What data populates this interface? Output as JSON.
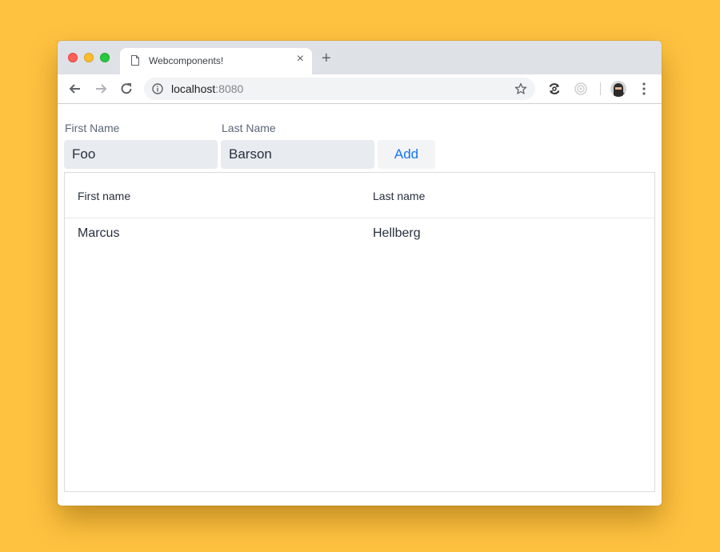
{
  "browser": {
    "tab": {
      "title": "Webcomponents!",
      "icon": "document-icon"
    },
    "url": {
      "host": "localhost",
      "port": ":8080"
    },
    "toolbar_icons": [
      "back-icon",
      "forward-icon",
      "reload-icon",
      "info-icon",
      "star-icon",
      "sync-extension-icon",
      "extension-icon",
      "profile-avatar",
      "menu-icon"
    ]
  },
  "form": {
    "first_name": {
      "label": "First Name",
      "value": "Foo"
    },
    "last_name": {
      "label": "Last Name",
      "value": "Barson"
    },
    "add_label": "Add"
  },
  "grid": {
    "columns": [
      "First name",
      "Last name"
    ],
    "rows": [
      [
        "Marcus",
        "Hellberg"
      ]
    ]
  }
}
